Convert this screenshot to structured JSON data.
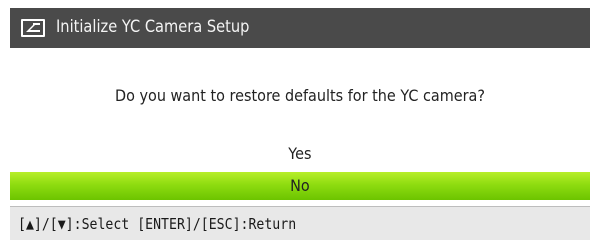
{
  "dialog": {
    "title": "Initialize YC Camera Setup",
    "icon": "return-arrow-icon",
    "question": "Do you want to restore defaults for the YC camera?",
    "options": [
      {
        "label": "Yes",
        "selected": false
      },
      {
        "label": "No",
        "selected": true
      }
    ],
    "footer": "[▲]/[▼]:Select  [ENTER]/[ESC]:Return"
  },
  "colors": {
    "title_bar": "#4a4a4a",
    "highlight": "#8edc10",
    "footer_bg": "#e8e8e8"
  }
}
